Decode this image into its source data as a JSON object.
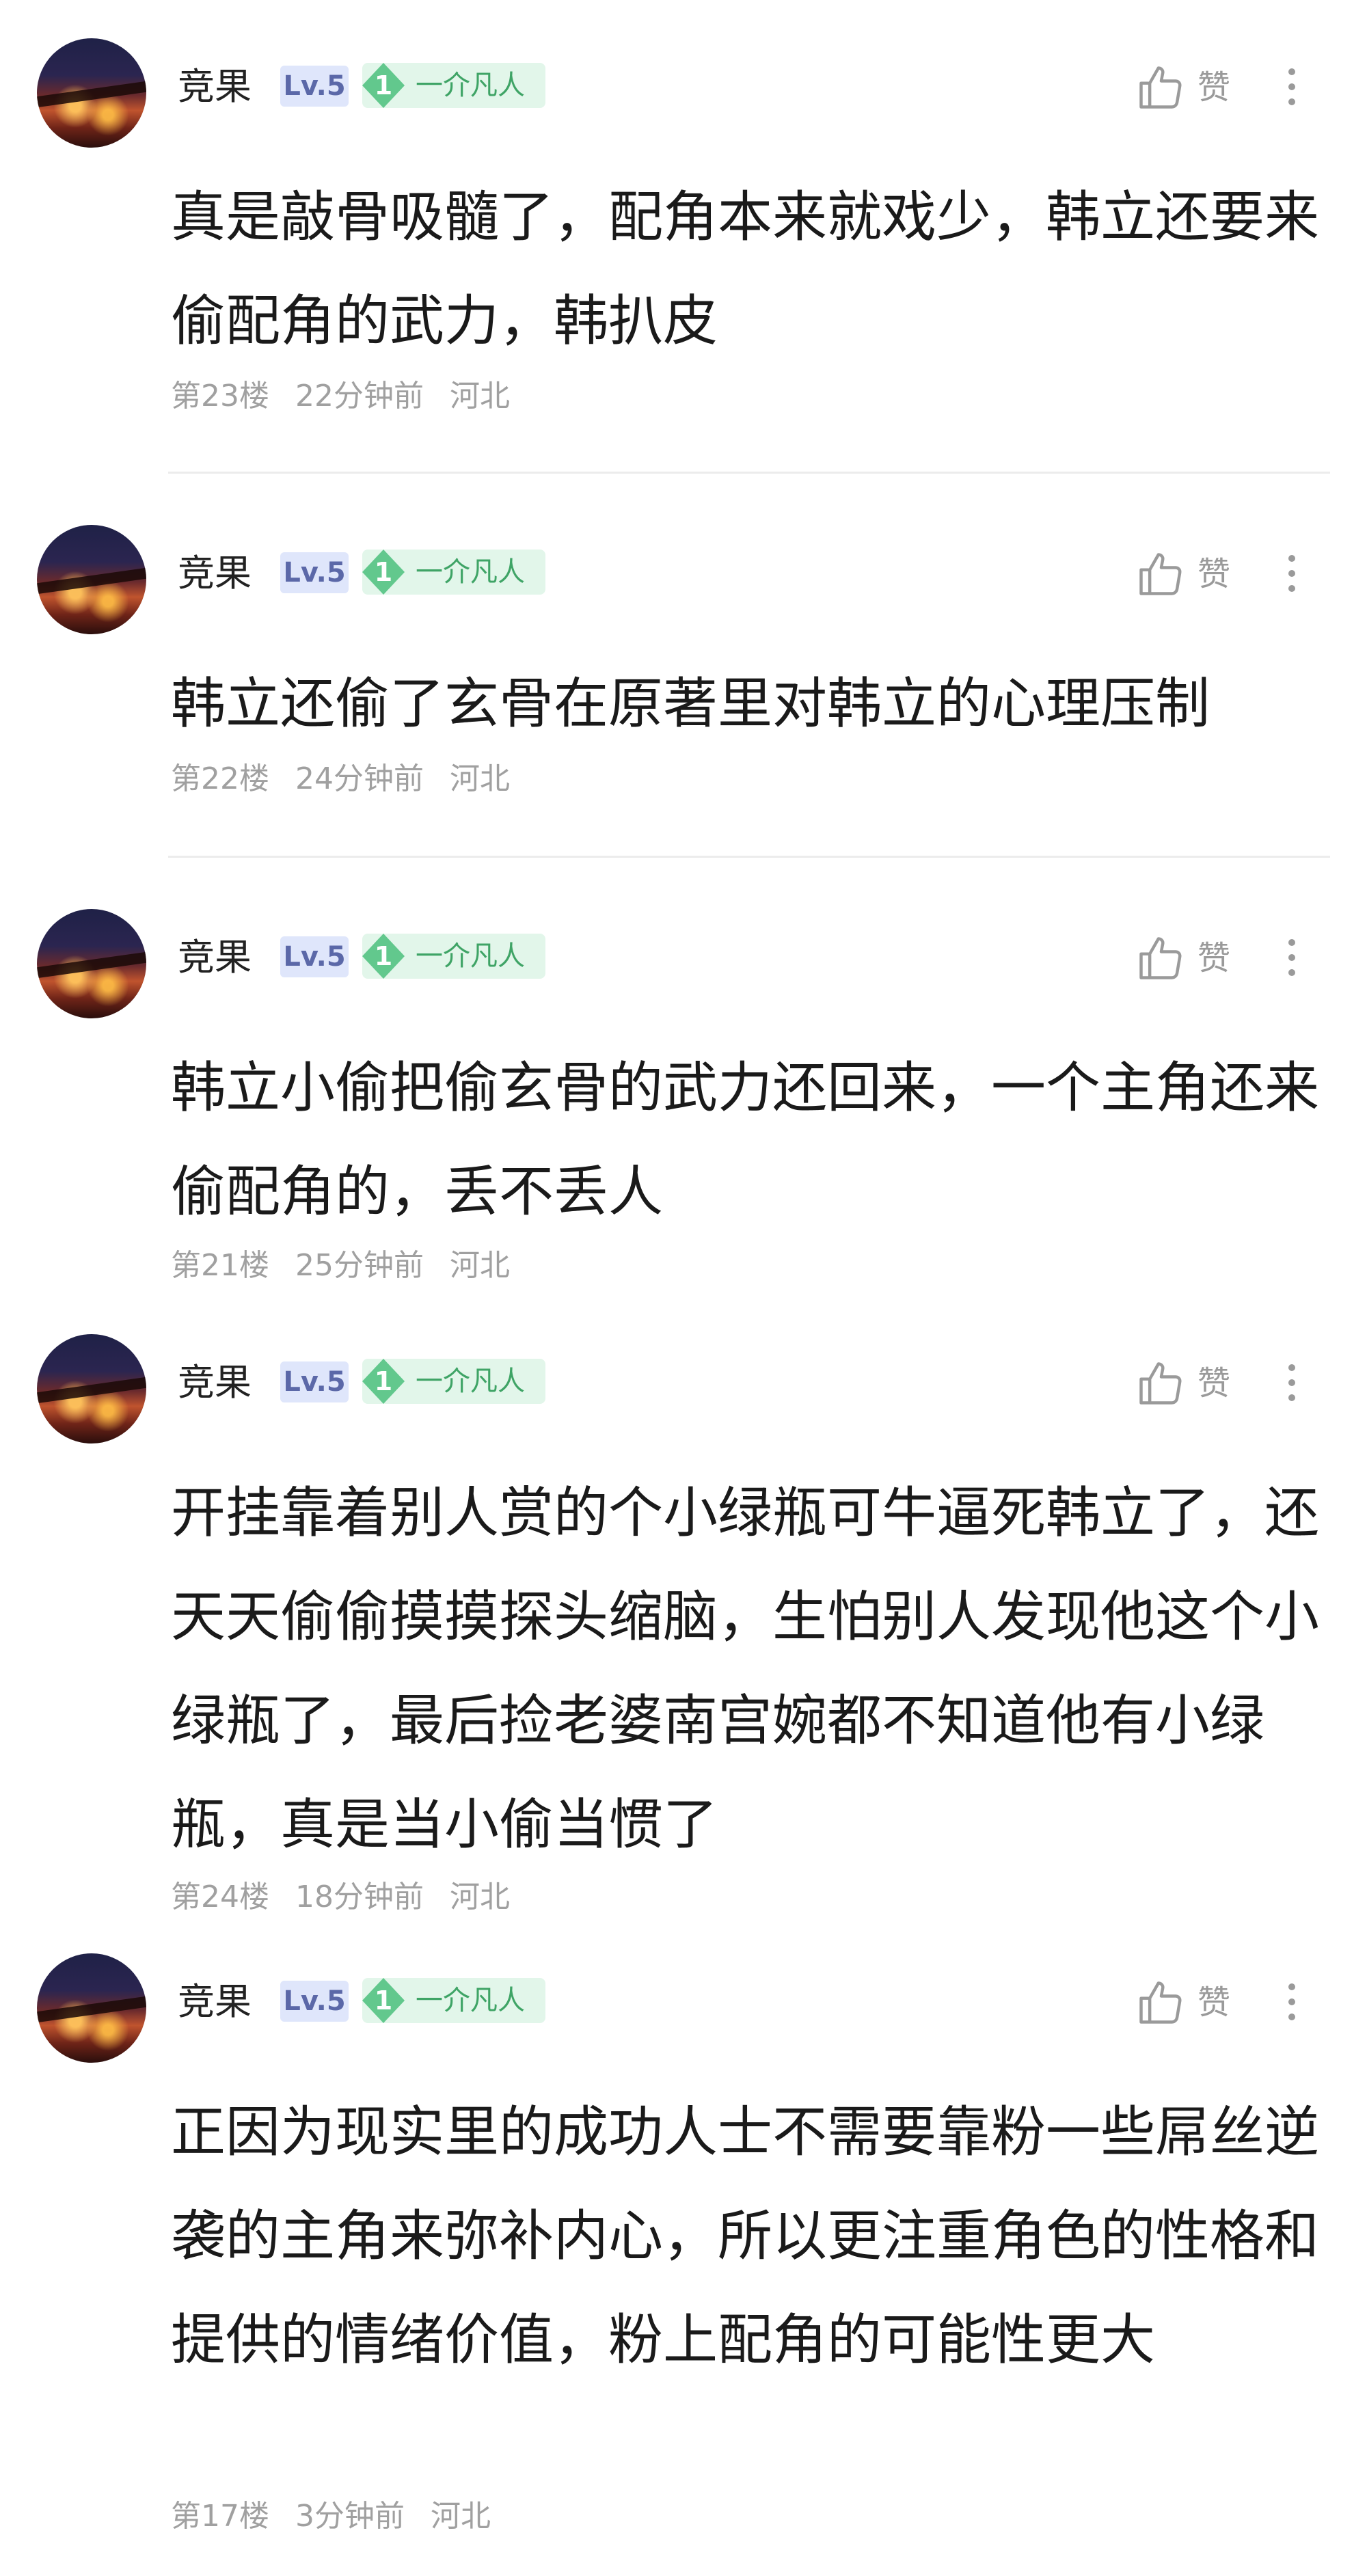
{
  "comments": [
    {
      "user": "竞果",
      "level": "Lv.5",
      "rank_num": "1",
      "rank_title": "一介凡人",
      "like_label": "赞",
      "content": "真是敲骨吸髓了，配角本来就戏少，韩立还要来偷配角的武力，韩扒皮",
      "floor": "第23楼",
      "time": "22分钟前",
      "location": "河北"
    },
    {
      "user": "竞果",
      "level": "Lv.5",
      "rank_num": "1",
      "rank_title": "一介凡人",
      "like_label": "赞",
      "content": "韩立还偷了玄骨在原著里对韩立的心理压制",
      "floor": "第22楼",
      "time": "24分钟前",
      "location": "河北"
    },
    {
      "user": "竞果",
      "level": "Lv.5",
      "rank_num": "1",
      "rank_title": "一介凡人",
      "like_label": "赞",
      "content": "韩立小偷把偷玄骨的武力还回来，一个主角还来偷配角的，丢不丢人",
      "floor": "第21楼",
      "time": "25分钟前",
      "location": "河北"
    },
    {
      "user": "竞果",
      "level": "Lv.5",
      "rank_num": "1",
      "rank_title": "一介凡人",
      "like_label": "赞",
      "content": "开挂靠着别人赏的个小绿瓶可牛逼死韩立了，还天天偷偷摸摸探头缩脑，生怕别人发现他这个小绿瓶了，最后捡老婆南宫婉都不知道他有小绿瓶，真是当小偷当惯了",
      "floor": "第24楼",
      "time": "18分钟前",
      "location": "河北"
    },
    {
      "user": "竞果",
      "level": "Lv.5",
      "rank_num": "1",
      "rank_title": "一介凡人",
      "like_label": "赞",
      "content": "正因为现实里的成功人士不需要靠粉一些屌丝逆袭的主角来弥补内心，所以更注重角色的性格和提供的情绪价值，粉上配角的可能性更大",
      "floor": "第17楼",
      "time": "3分钟前",
      "location": "河北"
    }
  ]
}
